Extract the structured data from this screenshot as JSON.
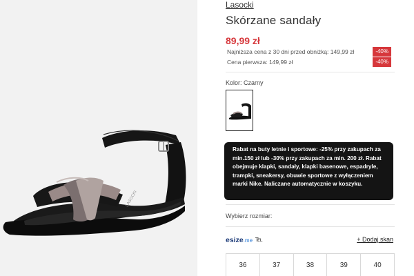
{
  "product": {
    "brand": "Lasocki",
    "title": "Skórzane sandały",
    "price": "89,99 zł",
    "lowest_price_label": "Najniższa cena z 30 dni przed obniżką: 149,99 zł",
    "lowest_price_badge": "-40%",
    "first_price_label": "Cena pierwsza: 149,99 zł",
    "first_price_badge": "-40%",
    "image_brand": "LASOCKI"
  },
  "color": {
    "label": "Kolor: Czarny"
  },
  "promo": {
    "text": "Rabat na buty letnie i sportowe: -25% przy zakupach za min.150 zł lub -30% przy zakupach za min. 200 zł. Rabat obejmuje klapki, sandały, klapki basenowe, espadryle, trampki, sneakersy, obuwie sportowe z wyłączeniem marki Nike. Naliczane automatycznie w koszyku."
  },
  "size": {
    "label": "Wybierz rozmiar:",
    "esize_logo": "esize",
    "esize_logo_suffix": ".me",
    "add_scan": "+ Dodaj skan",
    "options": [
      "36",
      "37",
      "38",
      "39",
      "40"
    ]
  },
  "colors": {
    "price_red": "#d6373b",
    "promo_bg": "#141414",
    "esize_blue": "#1e3c79"
  },
  "icons": {
    "foot_scan": "footprint-icon"
  }
}
